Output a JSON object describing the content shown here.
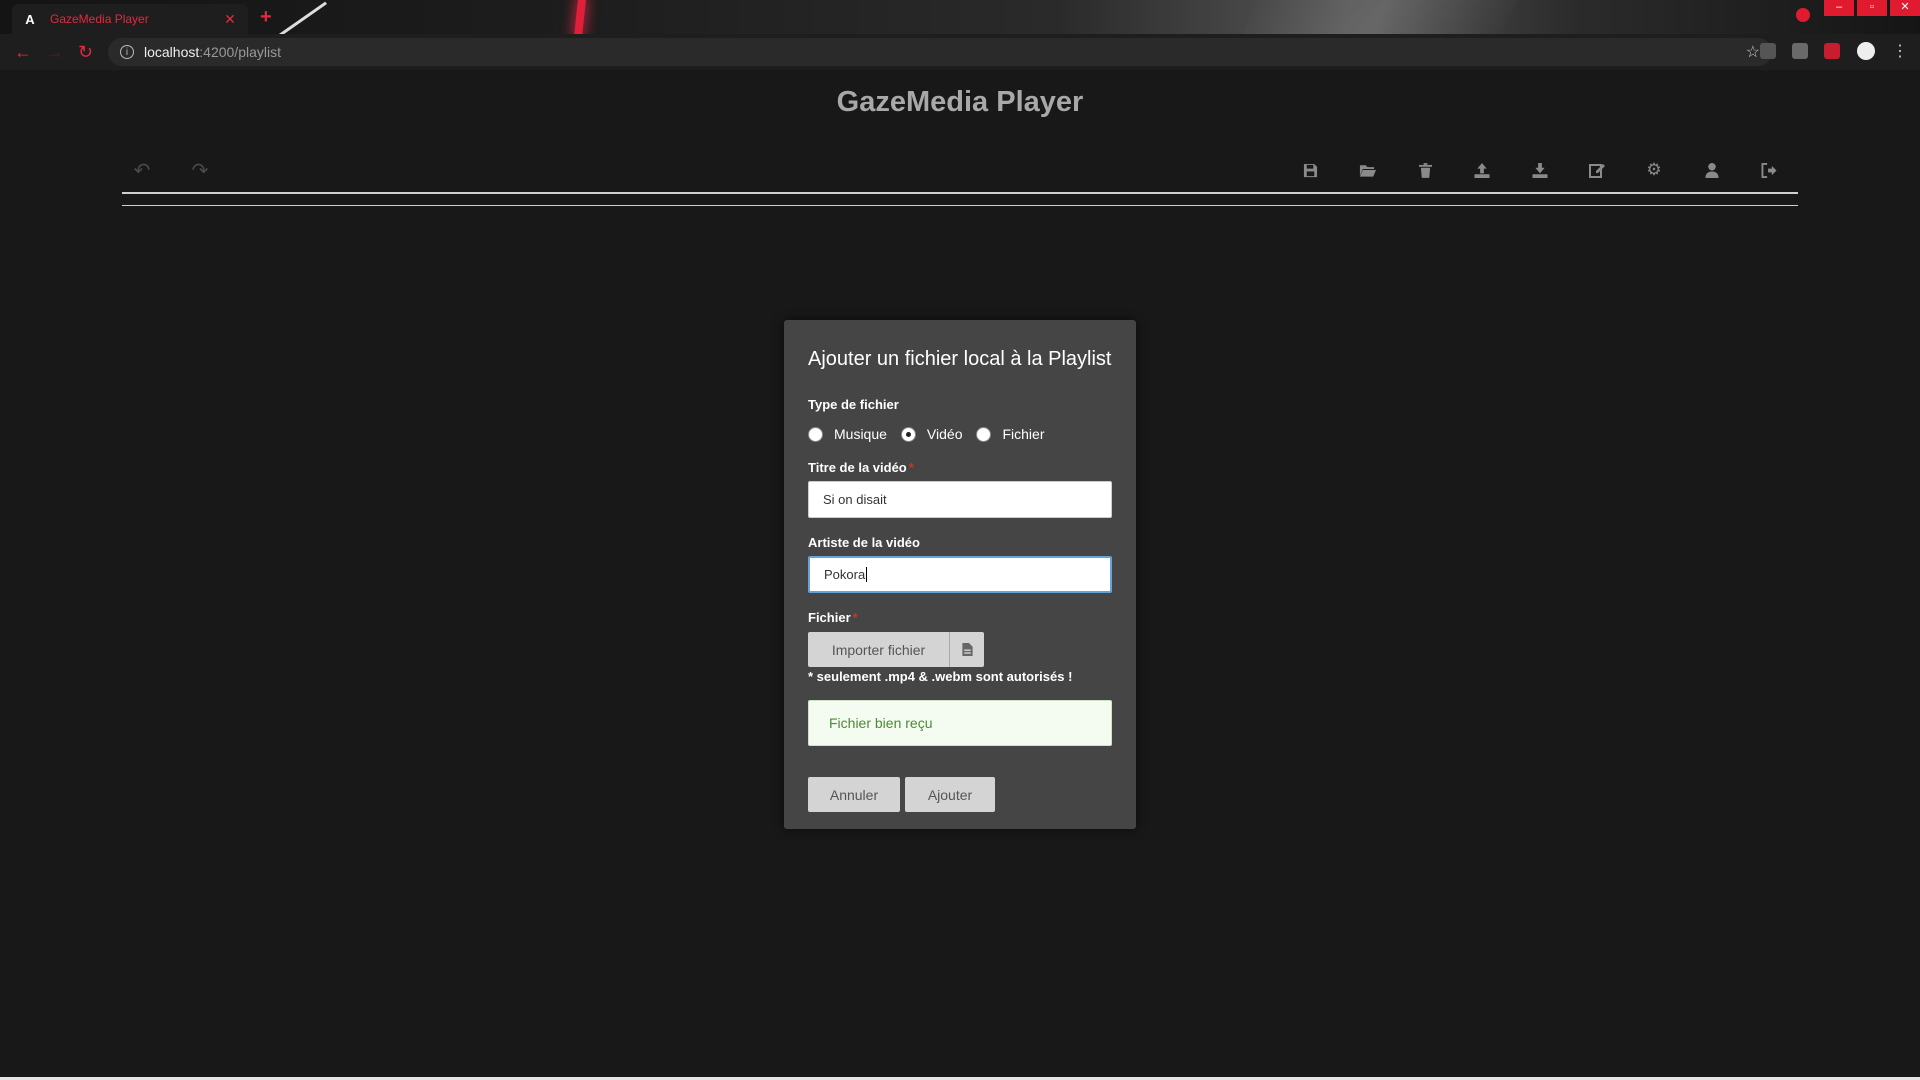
{
  "browser": {
    "tab_favicon": "A",
    "tab_title": "GazeMedia Player",
    "tab_close": "✕",
    "new_tab": "+",
    "url_host": "localhost",
    "url_path": ":4200/playlist",
    "accent_color": "#e5283f"
  },
  "app": {
    "title": "GazeMedia Player"
  },
  "toolbar": {
    "left_icons": [
      "undo-icon",
      "redo-icon"
    ],
    "right_icons": [
      "save-icon",
      "folder-open-icon",
      "trash-icon",
      "upload-icon",
      "download-icon",
      "edit-icon",
      "settings-icon",
      "user-icon",
      "logout-icon"
    ]
  },
  "modal": {
    "title": "Ajouter un fichier local à la Playlist",
    "type_label": "Type de fichier",
    "type_options": [
      {
        "label": "Musique",
        "checked": false
      },
      {
        "label": "Vidéo",
        "checked": true
      },
      {
        "label": "Fichier",
        "checked": false
      }
    ],
    "title_label": "Titre de la vidéo",
    "title_value": "Si on disait",
    "artist_label": "Artiste de la vidéo",
    "artist_value": "Pokora",
    "file_label": "Fichier",
    "required_mark": "*",
    "import_button": "Importer fichier",
    "file_hint": "* seulement .mp4 & .webm sont autorisés !",
    "success_message": "Fichier bien reçu",
    "cancel_button": "Annuler",
    "add_button": "Ajouter"
  }
}
